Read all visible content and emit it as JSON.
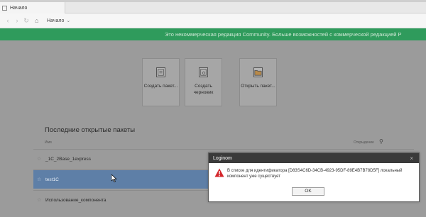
{
  "browser": {
    "tab_label": "Начало",
    "crumb": "Начало",
    "nav": {
      "back": "‹",
      "forward": "›",
      "refresh": "↻"
    }
  },
  "banner": {
    "text": "Это некоммерческая редакция Community. Больше возможностей с коммерческой редакцией Р"
  },
  "tiles": [
    {
      "label": "Создать пакет...",
      "icon": "package-icon"
    },
    {
      "label": "Создать черновик",
      "icon": "draft-icon"
    },
    {
      "label": "Открыть пакет...",
      "icon": "folder-icon"
    }
  ],
  "recent": {
    "title": "Последние открытые пакеты",
    "col_name": "Имя",
    "col_pinned": "Открыдение",
    "rows": [
      {
        "label": "_1C_2Base_1express",
        "selected": false
      },
      {
        "label": "test1C",
        "selected": true
      },
      {
        "label": "Использование_компонента",
        "selected": false
      }
    ]
  },
  "dialog": {
    "title": "Loginom",
    "message": "В списке для идентификатора [D83S4C6D-34CB-4923-95DF-89E4B7B78D5F] локальный компонент уже существует",
    "ok_label": "OK",
    "close": "×"
  },
  "colors": {
    "banner": "#2f9b5c",
    "selected_row": "#5e7fa7",
    "dialog_header": "#3a3a3a"
  }
}
